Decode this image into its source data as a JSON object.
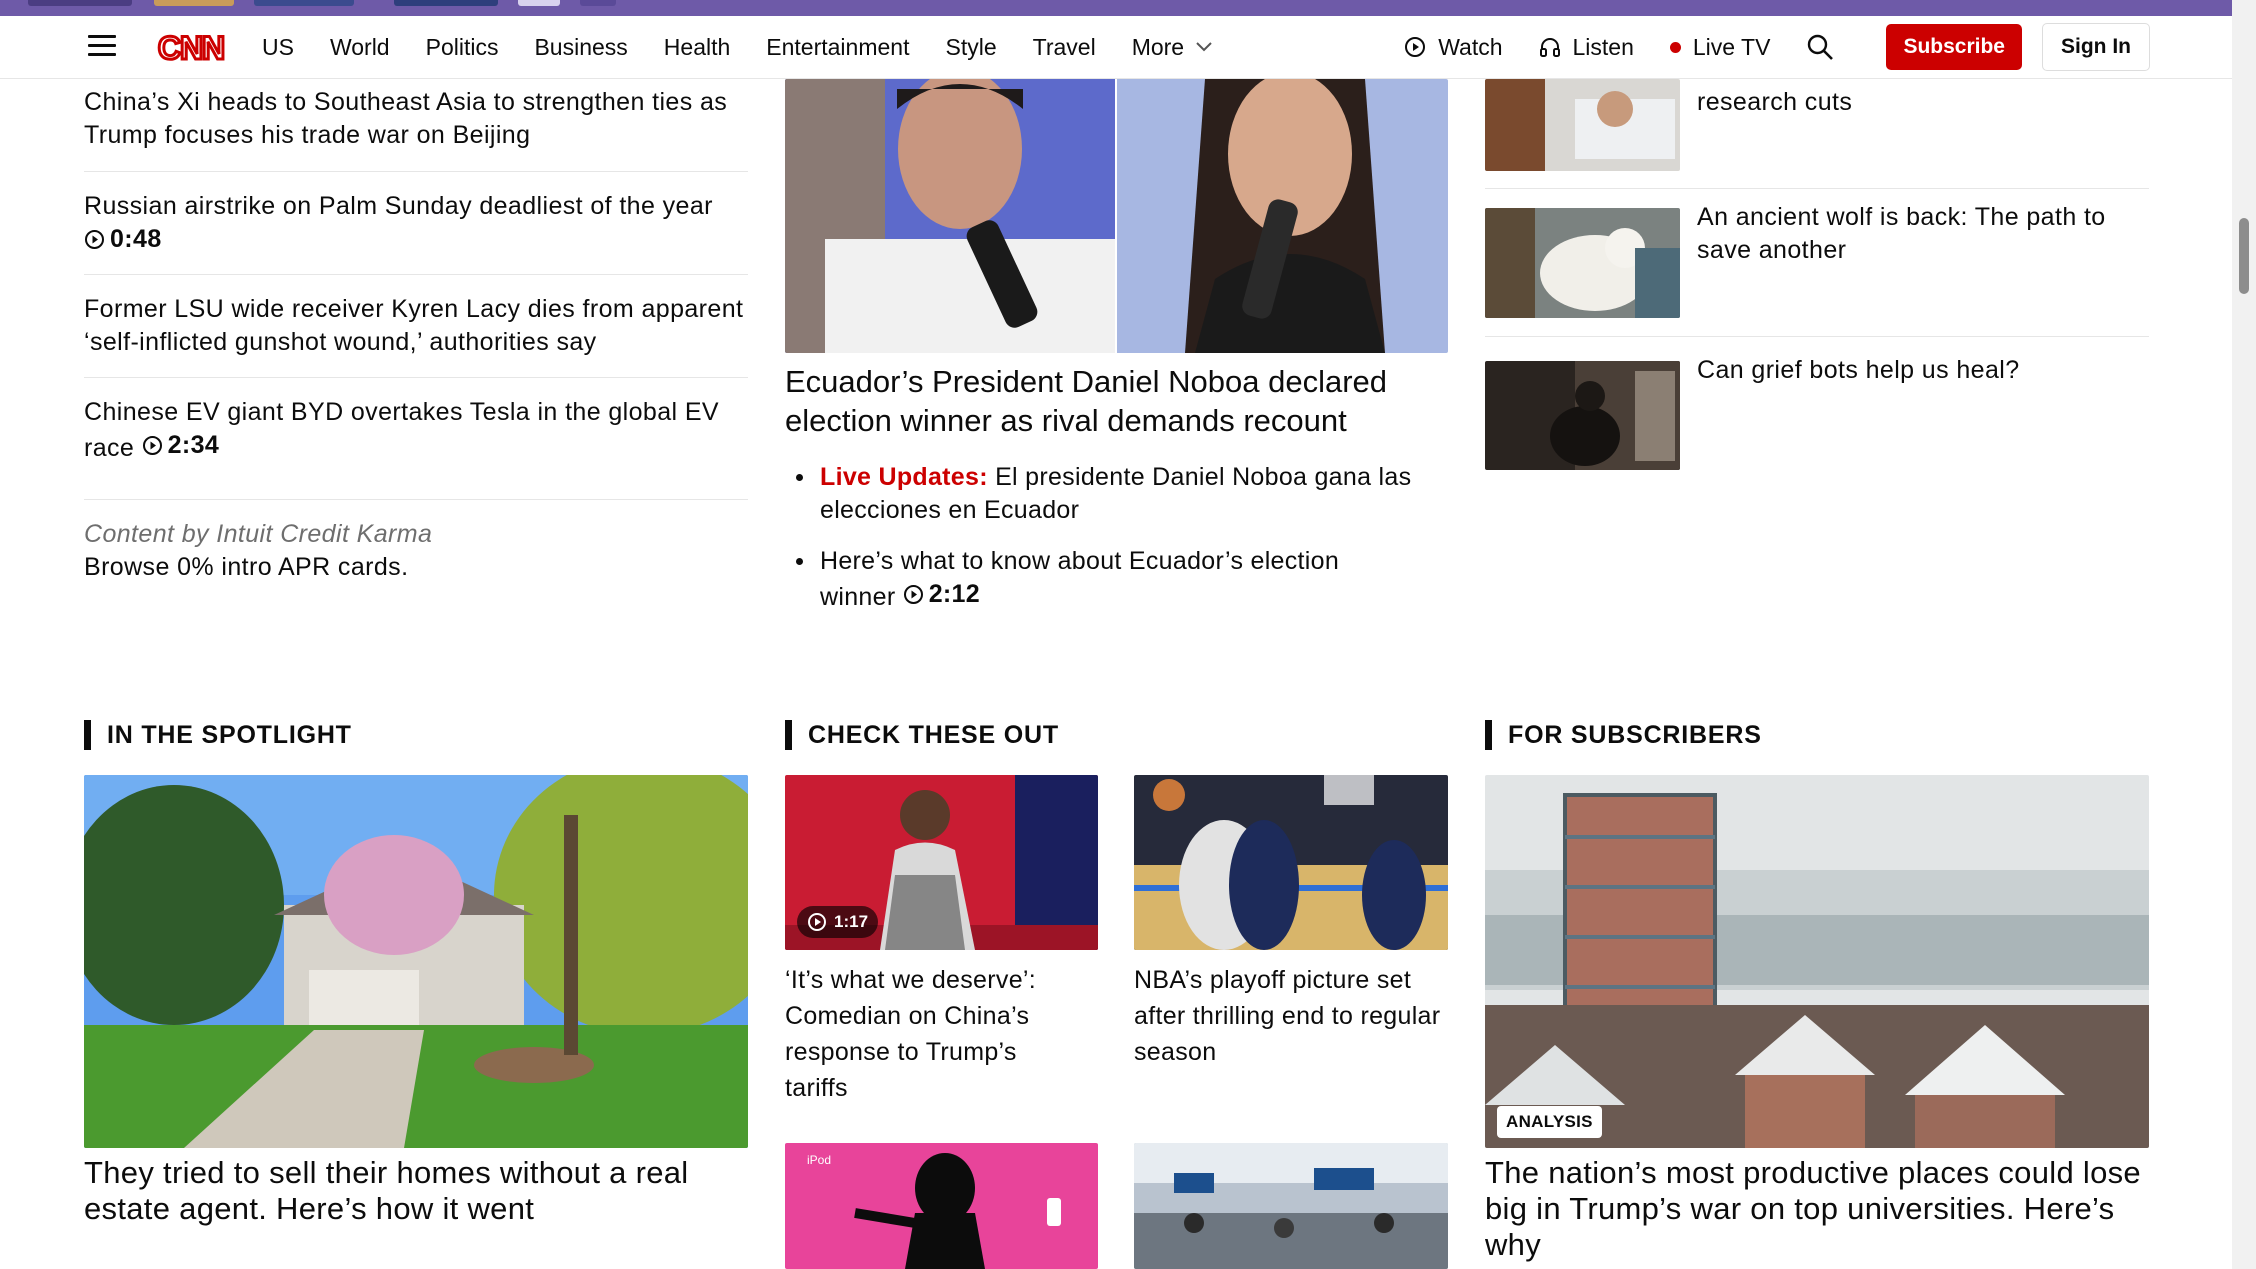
{
  "nav": {
    "links": [
      "US",
      "World",
      "Politics",
      "Business",
      "Health",
      "Entertainment",
      "Style",
      "Travel"
    ],
    "more_label": "More",
    "watch_label": "Watch",
    "listen_label": "Listen",
    "livetv_label": "Live TV",
    "subscribe_label": "Subscribe",
    "signin_label": "Sign In"
  },
  "colors": {
    "brand_red": "#cc0000",
    "accent_purple": "#6e5aa8"
  },
  "left_stories": [
    {
      "text": "China’s Xi heads to Southeast Asia to strengthen ties as Trump focuses his trade war on Beijing",
      "duration": ""
    },
    {
      "text": "Russian airstrike on Palm Sunday deadliest of the year",
      "duration": "0:48"
    },
    {
      "text": "Former LSU wide receiver Kyren Lacy dies from apparent ‘self-inflicted gunshot wound,’ authorities say",
      "duration": ""
    },
    {
      "text": "Chinese EV giant BYD overtakes Tesla in the global EV race",
      "duration": "2:34"
    }
  ],
  "sponsor": {
    "label": "Content by Intuit Credit Karma",
    "text": "Browse 0% intro APR cards."
  },
  "center": {
    "headline": "Ecuador’s President Daniel Noboa declared election winner as rival demands recount",
    "bullets": [
      {
        "live": "Live Updates:",
        "text": "El presidente Daniel Noboa gana las elecciones en Ecuador"
      },
      {
        "text": "Here’s what to know about Ecuador’s election winner",
        "duration": "2:12"
      }
    ]
  },
  "right_stories": [
    {
      "text": "research cuts"
    },
    {
      "text": "An ancient wolf is back: The path to save another"
    },
    {
      "text": "Can grief bots help us heal?"
    }
  ],
  "sections": {
    "spotlight": {
      "title": "IN THE SPOTLIGHT",
      "headline": "They tried to sell their homes without a real estate agent. Here’s how it went"
    },
    "check": {
      "title": "CHECK THESE OUT",
      "items": [
        {
          "text": "‘It’s what we deserve’: Comedian on China’s response to Trump’s tariffs",
          "duration": "1:17"
        },
        {
          "text": "NBA’s playoff picture set after thrilling end to regular season"
        }
      ],
      "ipod_label": "iPod"
    },
    "subscribers": {
      "title": "FOR SUBSCRIBERS",
      "badge": "ANALYSIS",
      "headline": "The nation’s most productive places could lose big in Trump’s war on top universities. Here’s why"
    }
  }
}
